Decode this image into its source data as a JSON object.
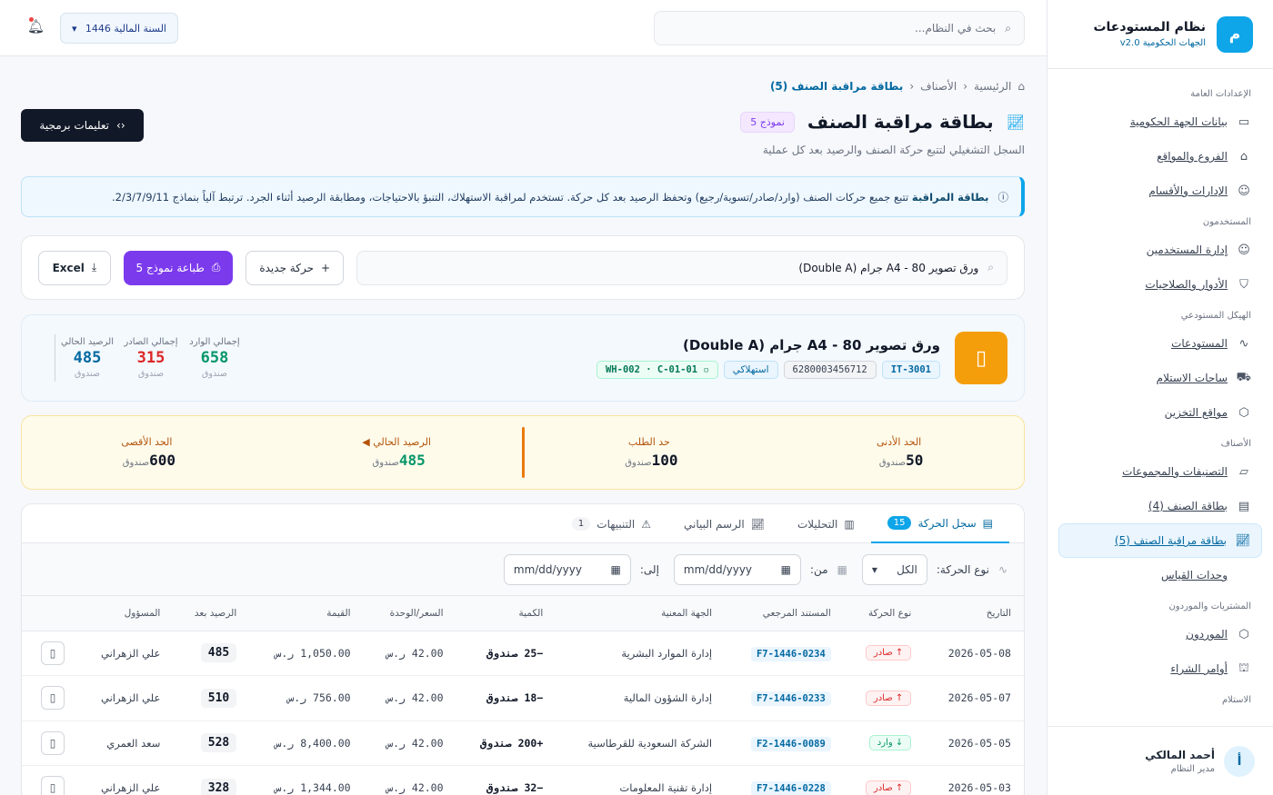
{
  "brand": {
    "logo": "م",
    "title": "نظام المستودعات",
    "subtitle": "الجهات الحكومية v2.0"
  },
  "sidebar": {
    "sections": [
      {
        "title": "الإعدادات العامة",
        "items": [
          {
            "label": "بيانات الجهة الحكومية",
            "icon": "monitor-icon"
          },
          {
            "label": "الفروع والمواقع",
            "icon": "home-icon"
          },
          {
            "label": "الإدارات والأقسام",
            "icon": "user-icon"
          }
        ]
      },
      {
        "title": "المستخدمون",
        "items": [
          {
            "label": "إدارة المستخدمين",
            "icon": "user-icon"
          },
          {
            "label": "الأدوار والصلاحيات",
            "icon": "shield-icon"
          }
        ]
      },
      {
        "title": "الهيكل المستودعي",
        "items": [
          {
            "label": "المستودعات",
            "icon": "activity-icon"
          },
          {
            "label": "ساحات الاستلام",
            "icon": "truck-icon"
          },
          {
            "label": "مواقع التخزين",
            "icon": "hexagon-icon"
          }
        ]
      },
      {
        "title": "الأصناف",
        "items": [
          {
            "label": "التصنيفات والمجموعات",
            "icon": "folder-icon"
          },
          {
            "label": "بطاقة الصنف (4)",
            "icon": "table-icon"
          },
          {
            "label": "بطاقة مراقبة الصنف (5)",
            "icon": "chart-icon",
            "active": true
          },
          {
            "label": "وحدات القياس",
            "icon": ""
          }
        ]
      },
      {
        "title": "المشتريات والموردون",
        "items": [
          {
            "label": "الموردون",
            "icon": "hexagon-icon"
          },
          {
            "label": "أوامر الشراء",
            "icon": "bag-icon"
          }
        ]
      },
      {
        "title": "الاستلام",
        "items": []
      }
    ]
  },
  "user": {
    "initial": "أ",
    "name": "أحمد المالكي",
    "role": "مدير النظام"
  },
  "topbar": {
    "search_placeholder": "بحث في النظام...",
    "year": "السنة المالية 1446"
  },
  "breadcrumb": [
    "الرئيسية",
    "الأصناف",
    "بطاقة مراقبة الصنف (5)"
  ],
  "page": {
    "title": "بطاقة مراقبة الصنف",
    "badge": "نموذج 5",
    "subtitle": "السجل التشغيلي لتتبع حركة الصنف والرصيد بعد كل عملية",
    "code_button": "تعليمات برمجية"
  },
  "info": {
    "bold": "بطاقة المراقبة",
    "text": "تتبع جميع حركات الصنف (وارد/صادر/تسوية/رجيع) وتحفظ الرصيد بعد كل حركة. تستخدم لمراقبة الاستهلاك، التنبؤ بالاحتياجات، ومطابقة الرصيد أثناء الجرد. ترتبط آلياً بنماذج 2/3/7/9/11."
  },
  "toolbar": {
    "search_value": "ورق تصوير A4 - 80 جرام (Double A)",
    "new_movement": "حركة جديدة",
    "print": "طباعة نموذج 5",
    "excel": "Excel"
  },
  "item": {
    "name": "ورق تصوير A4 - 80 جرام (Double A)",
    "code": "IT-3001",
    "barcode": "6280003456712",
    "type": "استهلاكي",
    "location": "WH-002 · C-01-01",
    "totals": [
      {
        "label": "إجمالي الوارد",
        "value": "658",
        "unit": "صندوق",
        "color": "#059669"
      },
      {
        "label": "إجمالي الصادر",
        "value": "315",
        "unit": "صندوق",
        "color": "#dc2626"
      },
      {
        "label": "الرصيد الحالي",
        "value": "485",
        "unit": "صندوق",
        "color": "#0369a1"
      }
    ]
  },
  "limits": [
    {
      "label": "الحد الأدنى",
      "value": "50",
      "unit": "صندوق"
    },
    {
      "label": "حد الطلب",
      "value": "100",
      "unit": "صندوق"
    },
    {
      "label": "الرصيد الحالي ◀",
      "value": "485",
      "unit": "صندوق",
      "highlight": true
    },
    {
      "label": "الحد الأقصى",
      "value": "600",
      "unit": "صندوق"
    }
  ],
  "tabs": [
    {
      "label": "سجل الحركة",
      "count": "15",
      "active": true,
      "icon": "file-icon"
    },
    {
      "label": "التحليلات",
      "icon": "bars-icon"
    },
    {
      "label": "الرسم البياني",
      "icon": "chart-icon"
    },
    {
      "label": "التنبيهات",
      "count": "1",
      "icon": "warning-icon"
    }
  ],
  "filters": {
    "type_label": "نوع الحركة:",
    "type_value": "الكل",
    "from_label": "من:",
    "to_label": "إلى:",
    "date_placeholder": "mm/dd/yyyy"
  },
  "table": {
    "headers": [
      "التاريخ",
      "نوع الحركة",
      "المستند المرجعي",
      "الجهة المعنية",
      "الكمية",
      "السعر/الوحدة",
      "القيمة",
      "الرصيد بعد",
      "المسؤول",
      ""
    ],
    "rows": [
      {
        "date": "2026-05-08",
        "type": "صادر",
        "dir": "out",
        "ref": "F7-1446-0234",
        "party": "إدارة الموارد البشرية",
        "qty": "−25 صندوق",
        "price": "42.00 ر.س",
        "value": "1,050.00 ر.س",
        "balance": "485",
        "owner": "علي الزهراني"
      },
      {
        "date": "2026-05-07",
        "type": "صادر",
        "dir": "out",
        "ref": "F7-1446-0233",
        "party": "إدارة الشؤون المالية",
        "qty": "−18 صندوق",
        "price": "42.00 ر.س",
        "value": "756.00 ر.س",
        "balance": "510",
        "owner": "علي الزهراني"
      },
      {
        "date": "2026-05-05",
        "type": "وارد",
        "dir": "in",
        "ref": "F2-1446-0089",
        "party": "الشركة السعودية للقرطاسية",
        "qty": "+200 صندوق",
        "price": "42.00 ر.س",
        "value": "8,400.00 ر.س",
        "balance": "528",
        "owner": "سعد العمري"
      },
      {
        "date": "2026-05-03",
        "type": "صادر",
        "dir": "out",
        "ref": "F7-1446-0228",
        "party": "إدارة تقنية المعلومات",
        "qty": "−32 صندوق",
        "price": "42.00 ر.س",
        "value": "1,344.00 ر.س",
        "balance": "328",
        "owner": "علي الزهراني"
      }
    ]
  }
}
